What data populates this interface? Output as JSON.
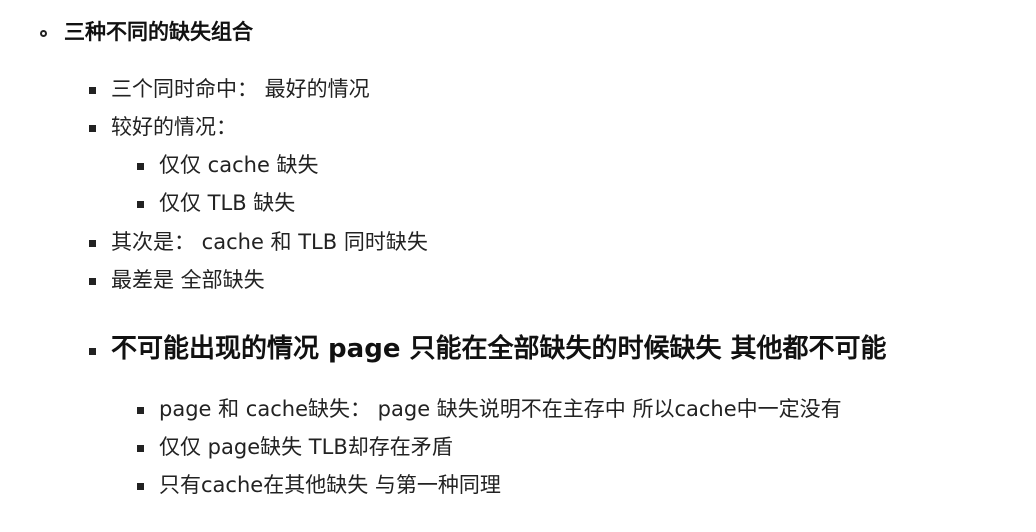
{
  "section": {
    "title": "三种不同的缺失组合",
    "items": [
      "三个同时命中： 最好的情况",
      "较好的情况：",
      "其次是： cache 和 TLB 同时缺失",
      "最差是 全部缺失"
    ],
    "subitems": [
      "仅仅 cache 缺失",
      "仅仅 TLB 缺失"
    ],
    "impossible": {
      "title": "不可能出现的情况 page 只能在全部缺失的时候缺失 其他都不可能",
      "items": [
        "page 和 cache缺失： page 缺失说明不在主存中 所以cache中一定没有",
        "仅仅 page缺失 TLB却存在矛盾",
        "只有cache在其他缺失 与第一种同理"
      ]
    }
  }
}
